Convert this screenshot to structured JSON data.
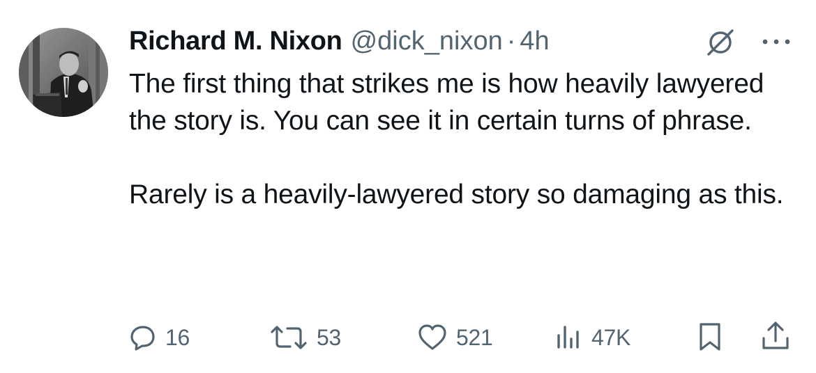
{
  "tweet": {
    "author": {
      "display_name": "Richard M. Nixon",
      "handle": "@dick_nixon",
      "avatar_icon": "avatar-photo"
    },
    "separator": "·",
    "time": "4h",
    "paragraphs": [
      "The first thing that strikes me is how heavily lawyered the story is. You can see it in certain turns of phrase.",
      "Rarely is a heavily-lawyered story so damaging as this."
    ],
    "header_icons": [
      "grok-icon",
      "more-icon"
    ]
  },
  "actions": {
    "reply": {
      "icon": "reply-icon",
      "count": "16"
    },
    "repost": {
      "icon": "repost-icon",
      "count": "53"
    },
    "like": {
      "icon": "heart-icon",
      "count": "521"
    },
    "views": {
      "icon": "views-icon",
      "count": "47K"
    },
    "bookmark": {
      "icon": "bookmark-icon"
    },
    "share": {
      "icon": "share-icon"
    }
  },
  "colors": {
    "text": "#0f1419",
    "muted": "#536471",
    "background": "#ffffff"
  }
}
